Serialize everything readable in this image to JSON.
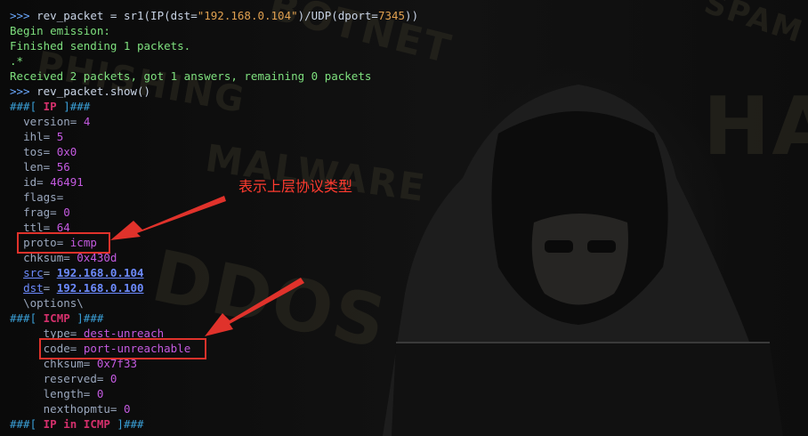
{
  "terminal": {
    "prompt": ">>>",
    "cmd1_pre": "rev_packet = sr1(IP(dst=",
    "cmd1_str1": "\"192.168.0.104\"",
    "cmd1_mid": ")/UDP(dport=",
    "cmd1_num": "7345",
    "cmd1_post": "))",
    "out1": "Begin emission:",
    "out2": "Finished sending 1 packets.",
    "out3": ".*",
    "out4": "Received 2 packets, got 1 answers, remaining 0 packets",
    "cmd2": "rev_packet.show()",
    "ip_header_pre": "###[ ",
    "ip_header_name": "IP",
    "ip_header_post": " ]###",
    "ip_fields": [
      {
        "key": "version",
        "value": "4"
      },
      {
        "key": "ihl",
        "value": "5"
      },
      {
        "key": "tos",
        "value": "0x0"
      },
      {
        "key": "len",
        "value": "56"
      },
      {
        "key": "id",
        "value": "46491"
      },
      {
        "key": "flags",
        "value": ""
      },
      {
        "key": "frag",
        "value": "0"
      },
      {
        "key": "ttl",
        "value": "64"
      },
      {
        "key": "proto",
        "value": "icmp"
      },
      {
        "key": "chksum",
        "value": "0x430d"
      },
      {
        "key": "src",
        "value": "192.168.0.104"
      },
      {
        "key": "dst",
        "value": "192.168.0.100"
      }
    ],
    "options": "\\options\\",
    "icmp_header_name": "ICMP",
    "icmp_fields": [
      {
        "key": "type",
        "value": "dest-unreach"
      },
      {
        "key": "code",
        "value": "port-unreachable"
      },
      {
        "key": "chksum",
        "value": "0x7f33"
      },
      {
        "key": "reserved",
        "value": "0"
      },
      {
        "key": "length",
        "value": "0"
      },
      {
        "key": "nexthopmtu",
        "value": "0"
      }
    ],
    "last_header_pre": "###[ ",
    "last_header_name": "IP in ICMP",
    "last_header_post": " ]###"
  },
  "annotation": {
    "label": "表示上层协议类型",
    "color": "#e0322b"
  },
  "watermark": {
    "w1": "BOTNET",
    "w2": "PHISHING",
    "w3": "MALWARE",
    "w4": "DDOS",
    "w5": "SPAM",
    "w6": "HA"
  },
  "colors": {
    "prompt": "#6aa8ff",
    "output": "#7ee07e",
    "value": "#c45ae0",
    "header": "#d4306c",
    "box": "#e0322b"
  }
}
